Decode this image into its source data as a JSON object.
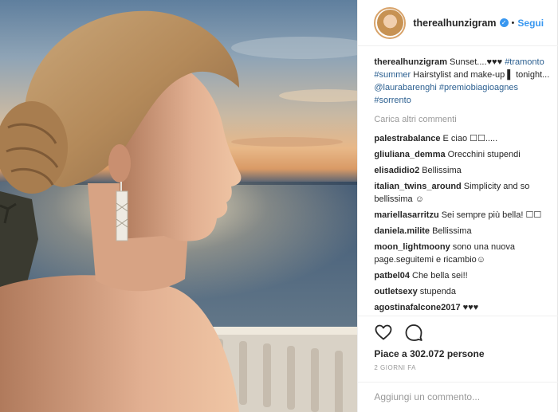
{
  "post": {
    "username": "therealhunzigram",
    "follow_label": "Segui",
    "separator": "•",
    "caption": {
      "username": "therealhunzigram",
      "text_before": "Sunset....♥♥♥",
      "tag1": "#tramonto",
      "tag2": "#summer",
      "text_mid": "Hairstylist and make-up ▌ tonight...",
      "mention": "@laurabarenghi",
      "tag3": "#premiobiagioagnes",
      "tag4": "#sorrento"
    },
    "load_more": "Carica altri commenti",
    "comments": [
      {
        "user": "palestrabalance",
        "text": "E ciao ☐☐....."
      },
      {
        "user": "gliuliana_demma",
        "text": "Orecchini stupendi"
      },
      {
        "user": "elisadidio2",
        "text": "Bellissima"
      },
      {
        "user": "italian_twins_around",
        "text": "Simplicity and so bellissima ☺"
      },
      {
        "user": "mariellasarritzu",
        "text": "Sei sempre più bella! ☐☐"
      },
      {
        "user": "daniela.milite",
        "text": "Bellissima"
      },
      {
        "user": "moon_lightmoony",
        "text": "sono una nuova page.seguitemi e ricambio☺"
      },
      {
        "user": "patbel04",
        "text": "Che bella sei!!"
      },
      {
        "user": "outletsexy",
        "text": "stupenda"
      },
      {
        "user": "agostinafalcone2017",
        "text": "♥♥♥"
      }
    ],
    "likes_prefix": "Piace a",
    "likes_count": "302.072",
    "likes_suffix": "persone",
    "date": "2 GIORNI FA",
    "add_comment_placeholder": "Aggiungi un commento..."
  },
  "colors": {
    "link": "#3897f0",
    "hashtag": "#2b5f90",
    "muted": "#999999"
  },
  "icons": [
    "verified-icon",
    "heart-icon",
    "comment-icon"
  ]
}
